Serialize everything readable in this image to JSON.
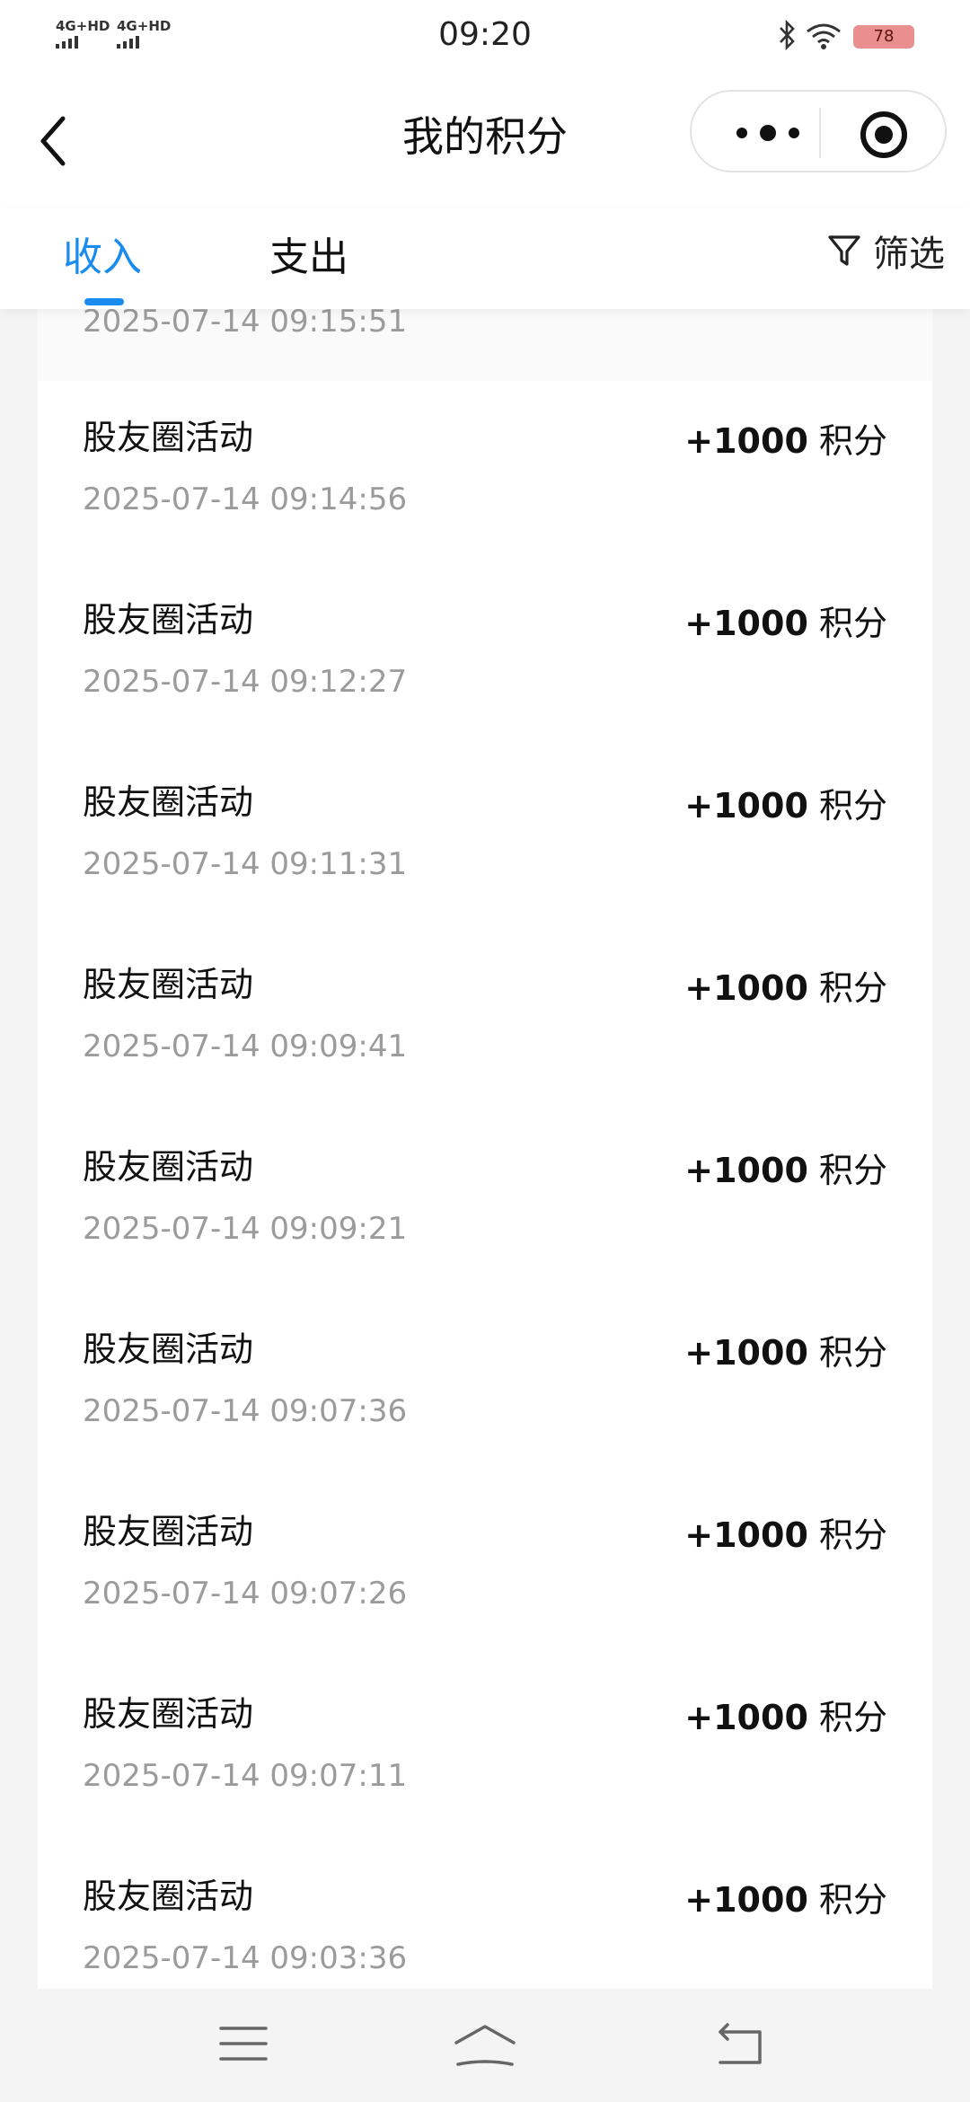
{
  "status_bar": {
    "network1": "4G+HD",
    "network2": "4G+HD",
    "time": "09:20",
    "battery": "78"
  },
  "header": {
    "title": "我的积分"
  },
  "tabs": {
    "income": "收入",
    "expense": "支出",
    "filter": "筛选",
    "active": "income"
  },
  "colors": {
    "accent": "#1a8cf0",
    "battery": "#e98f8f"
  },
  "partial_record": {
    "time": "2025-07-14 09:15:51"
  },
  "records": [
    {
      "title": "股友圈活动",
      "amount": "+1000",
      "unit": "积分",
      "time": "2025-07-14 09:14:56"
    },
    {
      "title": "股友圈活动",
      "amount": "+1000",
      "unit": "积分",
      "time": "2025-07-14 09:12:27"
    },
    {
      "title": "股友圈活动",
      "amount": "+1000",
      "unit": "积分",
      "time": "2025-07-14 09:11:31"
    },
    {
      "title": "股友圈活动",
      "amount": "+1000",
      "unit": "积分",
      "time": "2025-07-14 09:09:41"
    },
    {
      "title": "股友圈活动",
      "amount": "+1000",
      "unit": "积分",
      "time": "2025-07-14 09:09:21"
    },
    {
      "title": "股友圈活动",
      "amount": "+1000",
      "unit": "积分",
      "time": "2025-07-14 09:07:36"
    },
    {
      "title": "股友圈活动",
      "amount": "+1000",
      "unit": "积分",
      "time": "2025-07-14 09:07:26"
    },
    {
      "title": "股友圈活动",
      "amount": "+1000",
      "unit": "积分",
      "time": "2025-07-14 09:07:11"
    },
    {
      "title": "股友圈活动",
      "amount": "+1000",
      "unit": "积分",
      "time": "2025-07-14 09:03:36"
    }
  ],
  "icons": [
    "back-icon",
    "more-icon",
    "target-icon",
    "filter-icon",
    "menu-icon",
    "home-icon",
    "return-icon",
    "bluetooth-icon",
    "wifi-icon"
  ]
}
